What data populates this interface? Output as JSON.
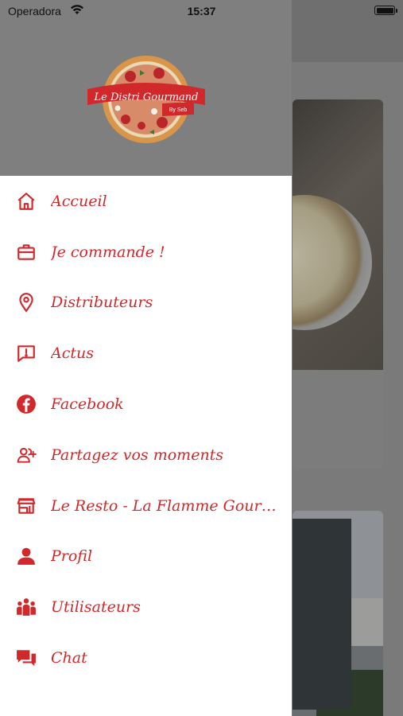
{
  "status_bar": {
    "carrier": "Operadora",
    "time": "15:37"
  },
  "brand": {
    "name": "Le Distri Gourmand",
    "byline": "By Seb",
    "accent_color": "#d1282b"
  },
  "menu": {
    "items": [
      {
        "label": "Accueil",
        "icon": "home-icon"
      },
      {
        "label": "Je commande !",
        "icon": "briefcase-icon"
      },
      {
        "label": "Distributeurs",
        "icon": "location-pin-icon"
      },
      {
        "label": "Actus",
        "icon": "announcement-icon"
      },
      {
        "label": "Facebook",
        "icon": "facebook-icon"
      },
      {
        "label": "Partagez vos moments",
        "icon": "add-people-icon"
      },
      {
        "label": "Le Resto - La Flamme Gourma...",
        "icon": "storefront-icon"
      },
      {
        "label": "Profil",
        "icon": "user-icon"
      },
      {
        "label": "Utilisateurs",
        "icon": "users-group-icon"
      },
      {
        "label": "Chat",
        "icon": "chat-bubbles-icon"
      }
    ]
  }
}
